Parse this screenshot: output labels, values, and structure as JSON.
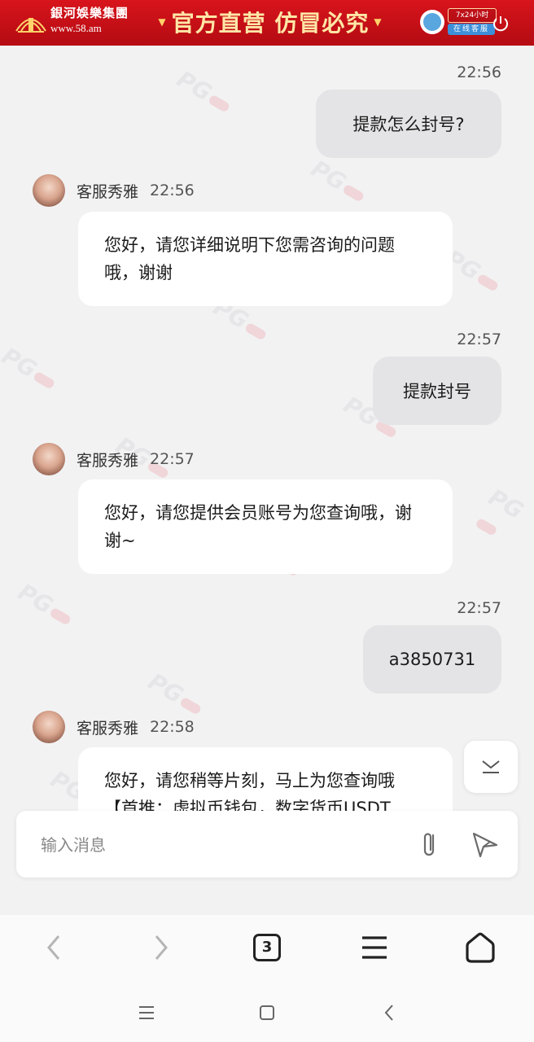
{
  "banner": {
    "brand_name": "銀河娛樂集團",
    "brand_url": "www.58.am",
    "slogan": "官方直营  仿冒必究",
    "support_hours": "7x24小时",
    "support_online": "在线客服"
  },
  "watermark_text": "PG",
  "chat": {
    "messages": [
      {
        "sender": "me",
        "time": "22:56",
        "text": "提款怎么封号?"
      },
      {
        "sender": "agent",
        "name": "客服秀雅",
        "time": "22:56",
        "text": "您好，请您详细说明下您需咨询的问题哦，谢谢"
      },
      {
        "sender": "me",
        "time": "22:57",
        "text": "提款封号"
      },
      {
        "sender": "agent",
        "name": "客服秀雅",
        "time": "22:57",
        "text": "您好，请您提供会员账号为您查询哦，谢谢~"
      },
      {
        "sender": "me",
        "time": "22:57",
        "text": "a3850731"
      },
      {
        "sender": "agent",
        "name": "客服秀雅",
        "time": "22:58",
        "text": "您好，请您稍等片刻，马上为您查询哦【首推：虚拟币钱包，数字货币USDT"
      }
    ]
  },
  "input": {
    "placeholder": "输入消息"
  },
  "toolbar": {
    "tab_count": "3"
  },
  "icons": {
    "back": "chevron-left-icon",
    "forward": "chevron-right-icon",
    "tabs": "tab-count-icon",
    "menu": "hamburger-icon",
    "home": "home-icon",
    "attach": "paperclip-icon",
    "send": "send-icon",
    "scroll": "chevron-down-icon"
  },
  "colors": {
    "banner_red": "#c8101a",
    "slogan_gold": "#ffe6a6",
    "bubble_me": "#e4e4e6",
    "bubble_agent": "#ffffff",
    "background": "#f2f2f3"
  }
}
